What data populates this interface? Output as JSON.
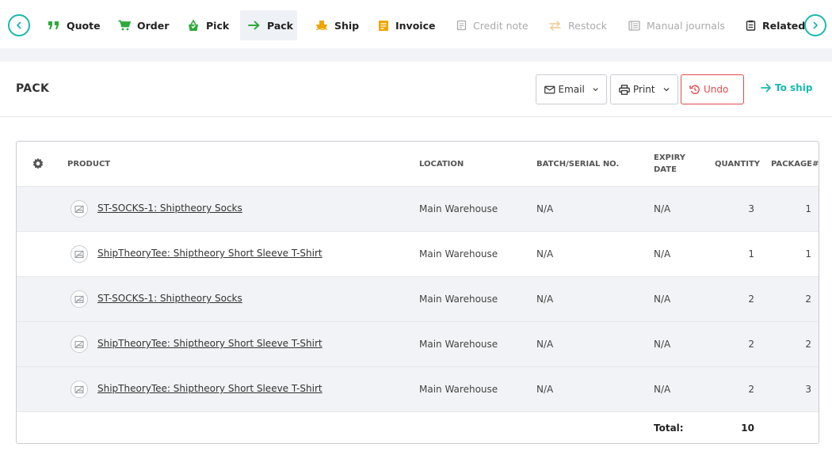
{
  "nav": {
    "items": [
      {
        "label": "Quote",
        "icon": "quote-icon",
        "state": "normal"
      },
      {
        "label": "Order",
        "icon": "cart-icon",
        "state": "normal"
      },
      {
        "label": "Pick",
        "icon": "basket-icon",
        "state": "normal"
      },
      {
        "label": "Pack",
        "icon": "arrow-right-icon",
        "state": "active"
      },
      {
        "label": "Ship",
        "icon": "ship-icon",
        "state": "normal"
      },
      {
        "label": "Invoice",
        "icon": "invoice-icon",
        "state": "normal"
      },
      {
        "label": "Credit note",
        "icon": "credit-note-icon",
        "state": "disabled"
      },
      {
        "label": "Restock",
        "icon": "restock-icon",
        "state": "disabled"
      },
      {
        "label": "Manual journals",
        "icon": "journal-icon",
        "state": "disabled"
      },
      {
        "label": "Related",
        "icon": "related-icon",
        "state": "normal"
      }
    ]
  },
  "header": {
    "title": "PACK",
    "email_label": "Email",
    "print_label": "Print",
    "undo_label": "Undo",
    "to_ship_label": "To ship"
  },
  "table": {
    "columns": {
      "product": "PRODUCT",
      "location": "LOCATION",
      "batch": "BATCH/SERIAL NO.",
      "expiry_line1": "EXPIRY",
      "expiry_line2": "DATE",
      "quantity": "QUANTITY",
      "package": "PACKAGE#"
    },
    "rows": [
      {
        "product": "ST-SOCKS-1: Shiptheory Socks",
        "location": "Main Warehouse",
        "batch": "N/A",
        "expiry": "N/A",
        "quantity": "3",
        "package": "1"
      },
      {
        "product": "ShipTheoryTee: Shiptheory Short Sleeve T-Shirt",
        "location": "Main Warehouse",
        "batch": "N/A",
        "expiry": "N/A",
        "quantity": "1",
        "package": "1"
      },
      {
        "product": "ST-SOCKS-1: Shiptheory Socks",
        "location": "Main Warehouse",
        "batch": "N/A",
        "expiry": "N/A",
        "quantity": "2",
        "package": "2"
      },
      {
        "product": "ShipTheoryTee: Shiptheory Short Sleeve T-Shirt",
        "location": "Main Warehouse",
        "batch": "N/A",
        "expiry": "N/A",
        "quantity": "2",
        "package": "2"
      },
      {
        "product": "ShipTheoryTee: Shiptheory Short Sleeve T-Shirt",
        "location": "Main Warehouse",
        "batch": "N/A",
        "expiry": "N/A",
        "quantity": "2",
        "package": "3"
      }
    ],
    "total_label": "Total:",
    "total_value": "10"
  },
  "colors": {
    "accent": "#1ab9b0",
    "green": "#2eaa3c",
    "orange": "#f0a500",
    "danger": "#e24b4b"
  }
}
